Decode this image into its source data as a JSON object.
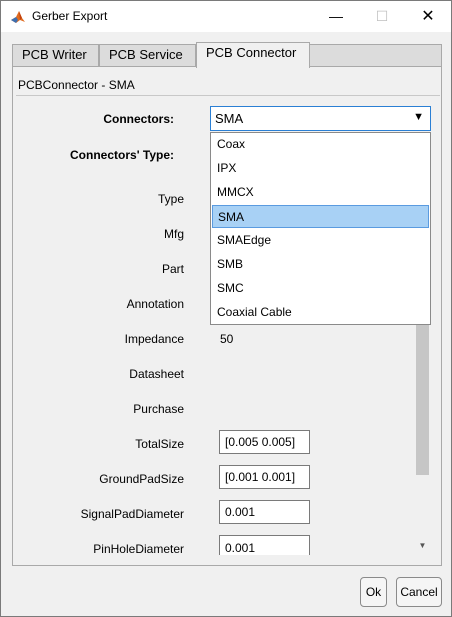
{
  "window": {
    "title": "Gerber Export",
    "minimize": "—",
    "maximize": "☐",
    "close": "✕"
  },
  "tabs": [
    {
      "label": "PCB Writer",
      "active": false
    },
    {
      "label": "PCB Service",
      "active": false
    },
    {
      "label": "PCB Connector",
      "active": true
    }
  ],
  "panel": {
    "title": "PCBConnector - SMA",
    "connectors_label": "Connectors:",
    "connectors_type_label": "Connectors' Type:",
    "connectors_value": "SMA",
    "dropdown_arrow": "▼",
    "dropdown_options": [
      "Coax",
      "IPX",
      "MMCX",
      "SMA",
      "SMAEdge",
      "SMB",
      "SMC",
      "Coaxial Cable"
    ],
    "selected_option": "SMA"
  },
  "properties": {
    "type_label": "Type",
    "mfg_label": "Mfg",
    "part_label": "Part",
    "annotation_label": "Annotation",
    "impedance_label": "Impedance",
    "impedance_value": "50",
    "datasheet_label": "Datasheet",
    "purchase_label": "Purchase",
    "total_size_label": "TotalSize",
    "total_size_value": "[0.005 0.005]",
    "ground_pad_size_label": "GroundPadSize",
    "ground_pad_size_value": "[0.001 0.001]",
    "signal_pad_diameter_label": "SignalPadDiameter",
    "signal_pad_diameter_value": "0.001",
    "pin_hole_diameter_label": "PinHoleDiameter",
    "pin_hole_diameter_value": "0.001"
  },
  "scrollbar": {
    "down_arrow": "▼"
  },
  "buttons": {
    "ok": "Ok",
    "cancel": "Cancel"
  },
  "colors": {
    "accent": "#2a7fd4",
    "selection": "#a8d1f5"
  }
}
